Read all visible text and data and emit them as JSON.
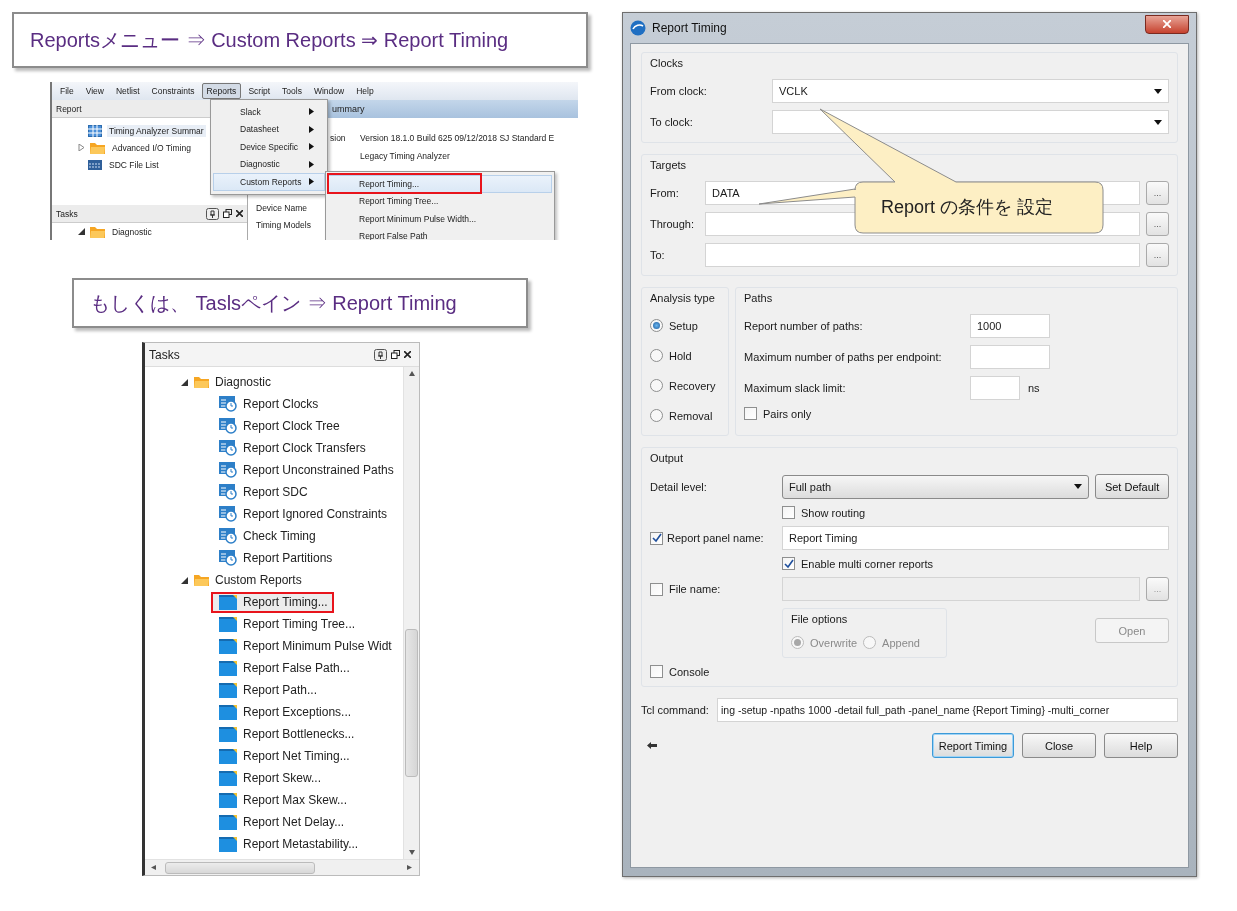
{
  "menu_hint": {
    "text": "Reportsメニュー ⇒ Custom Reports ⇒ Report Timing"
  },
  "menu_screenshot": {
    "menubar": [
      {
        "label": "File",
        "selected": false
      },
      {
        "label": "View",
        "selected": false
      },
      {
        "label": "Netlist",
        "selected": false
      },
      {
        "label": "Constraints",
        "selected": false
      },
      {
        "label": "Reports",
        "selected": true
      },
      {
        "label": "Script",
        "selected": false
      },
      {
        "label": "Tools",
        "selected": false
      },
      {
        "label": "Window",
        "selected": false
      },
      {
        "label": "Help",
        "selected": false
      }
    ],
    "report_pane": {
      "title": "Report",
      "items": [
        {
          "label": "Timing Analyzer Summar",
          "kind": "table",
          "selected": true
        },
        {
          "label": "Advanced I/O Timing",
          "kind": "folder",
          "selected": false
        },
        {
          "label": "SDC File List",
          "kind": "list",
          "selected": false
        }
      ]
    },
    "tasks_pane": {
      "title": "Tasks",
      "items": [
        {
          "label": "Diagnostic",
          "expanded": true
        }
      ]
    },
    "summary": {
      "header": "ummary",
      "rows": [
        {
          "label": "sion",
          "value": "Version 18.1.0 Build 625 09/12/2018 SJ Standard E"
        },
        {
          "value": "Legacy Timing Analyzer"
        },
        {
          "label": "Device Name"
        },
        {
          "label": "Timing Models"
        }
      ]
    },
    "reports_menu": {
      "items": [
        {
          "label": "Slack",
          "selected": false
        },
        {
          "label": "Datasheet",
          "selected": false
        },
        {
          "label": "Device Specific",
          "selected": false
        },
        {
          "label": "Diagnostic",
          "selected": false
        },
        {
          "label": "Custom Reports",
          "selected": true
        }
      ]
    },
    "custom_reports_menu": {
      "items": [
        {
          "label": "Report Timing...",
          "selected": true,
          "annotated": true
        },
        {
          "label": "Report Timing Tree...",
          "selected": false,
          "annotated": false
        },
        {
          "label": "Report Minimum Pulse Width...",
          "selected": false,
          "annotated": false
        },
        {
          "label": "Report False Path",
          "selected": false,
          "annotated": false
        }
      ]
    }
  },
  "tasks_hint": {
    "text": "もしくは、 Taslsペイン ⇒ Report Timing"
  },
  "tasks_panel": {
    "title": "Tasks",
    "groups": [
      {
        "label": "Diagnostic",
        "expanded": true,
        "children": [
          {
            "label": "Report Clocks",
            "kind": "diagnostic",
            "selected": false,
            "annotated": false
          },
          {
            "label": "Report Clock Tree",
            "kind": "diagnostic",
            "selected": false,
            "annotated": false
          },
          {
            "label": "Report Clock Transfers",
            "kind": "diagnostic",
            "selected": false,
            "annotated": false
          },
          {
            "label": "Report Unconstrained Paths",
            "kind": "diagnostic",
            "selected": false,
            "annotated": false
          },
          {
            "label": "Report SDC",
            "kind": "diagnostic",
            "selected": false,
            "annotated": false
          },
          {
            "label": "Report Ignored Constraints",
            "kind": "diagnostic",
            "selected": false,
            "annotated": false
          },
          {
            "label": "Check Timing",
            "kind": "diagnostic",
            "selected": false,
            "annotated": false
          },
          {
            "label": "Report Partitions",
            "kind": "diagnostic",
            "selected": false,
            "annotated": false
          }
        ]
      },
      {
        "label": "Custom Reports",
        "expanded": true,
        "children": [
          {
            "label": "Report Timing...",
            "kind": "custom",
            "selected": true,
            "annotated": true
          },
          {
            "label": "Report Timing Tree...",
            "kind": "custom",
            "selected": false,
            "annotated": false
          },
          {
            "label": "Report Minimum Pulse Widt",
            "kind": "custom",
            "selected": false,
            "annotated": false
          },
          {
            "label": "Report False Path...",
            "kind": "custom",
            "selected": false,
            "annotated": false
          },
          {
            "label": "Report Path...",
            "kind": "custom",
            "selected": false,
            "annotated": false
          },
          {
            "label": "Report Exceptions...",
            "kind": "custom",
            "selected": false,
            "annotated": false
          },
          {
            "label": "Report Bottlenecks...",
            "kind": "custom",
            "selected": false,
            "annotated": false
          },
          {
            "label": "Report Net Timing...",
            "kind": "custom",
            "selected": false,
            "annotated": false
          },
          {
            "label": "Report Skew...",
            "kind": "custom",
            "selected": false,
            "annotated": false
          },
          {
            "label": "Report Max Skew...",
            "kind": "custom",
            "selected": false,
            "annotated": false
          },
          {
            "label": "Report Net Delay...",
            "kind": "custom",
            "selected": false,
            "annotated": false
          },
          {
            "label": "Report Metastability...",
            "kind": "custom",
            "selected": false,
            "annotated": false
          }
        ]
      }
    ]
  },
  "dialog": {
    "title": "Report Timing",
    "clocks": {
      "title": "Clocks",
      "rows": [
        {
          "label": "From clock:",
          "value": "VCLK"
        },
        {
          "label": "To clock:"
        }
      ]
    },
    "targets": {
      "title": "Targets",
      "rows": [
        {
          "label": "From:",
          "value": "DATA",
          "button": "..."
        },
        {
          "label": "Through:",
          "button": "..."
        },
        {
          "label": "To:",
          "button": "..."
        }
      ]
    },
    "analysis": {
      "title": "Analysis type",
      "options": [
        {
          "label": "Setup",
          "selected": true
        },
        {
          "label": "Hold",
          "selected": false
        },
        {
          "label": "Recovery",
          "selected": false
        },
        {
          "label": "Removal",
          "selected": false
        }
      ]
    },
    "paths": {
      "title": "Paths",
      "fields": [
        {
          "label": "Report number of paths:",
          "value": "1000"
        },
        {
          "label": "Maximum number of paths per endpoint:"
        },
        {
          "label": "Maximum slack limit:",
          "unit": "ns"
        }
      ],
      "pairs_only": {
        "label": "Pairs only",
        "checked": false
      }
    },
    "output": {
      "title": "Output",
      "detail_level": {
        "label": "Detail level:",
        "value": "Full path"
      },
      "set_default": "Set Default",
      "show_routing": {
        "label": "Show routing",
        "checked": false
      },
      "report_panel": {
        "label": "Report panel name:",
        "checked": true,
        "value": "Report Timing"
      },
      "multi_corner": {
        "label": "Enable multi corner reports",
        "checked": true
      },
      "file_name": {
        "label": "File name:",
        "checked": false,
        "disabled": true,
        "button": "..."
      },
      "file_options": {
        "title": "File options",
        "disabled": true,
        "options": [
          {
            "label": "Overwrite",
            "selected": true
          },
          {
            "label": "Append",
            "selected": false
          }
        ]
      },
      "open_button": {
        "label": "Open",
        "disabled": true
      },
      "console": {
        "label": "Console",
        "checked": false
      }
    },
    "tcl": {
      "label": "Tcl command:",
      "value": "ing -setup -npaths 1000 -detail full_path -panel_name {Report Timing} -multi_corner"
    },
    "buttons": [
      {
        "label": "Report Timing",
        "default": true
      },
      {
        "label": "Close",
        "default": false
      },
      {
        "label": "Help",
        "default": false
      }
    ],
    "callout": {
      "text": "Report の条件を 設定"
    }
  }
}
